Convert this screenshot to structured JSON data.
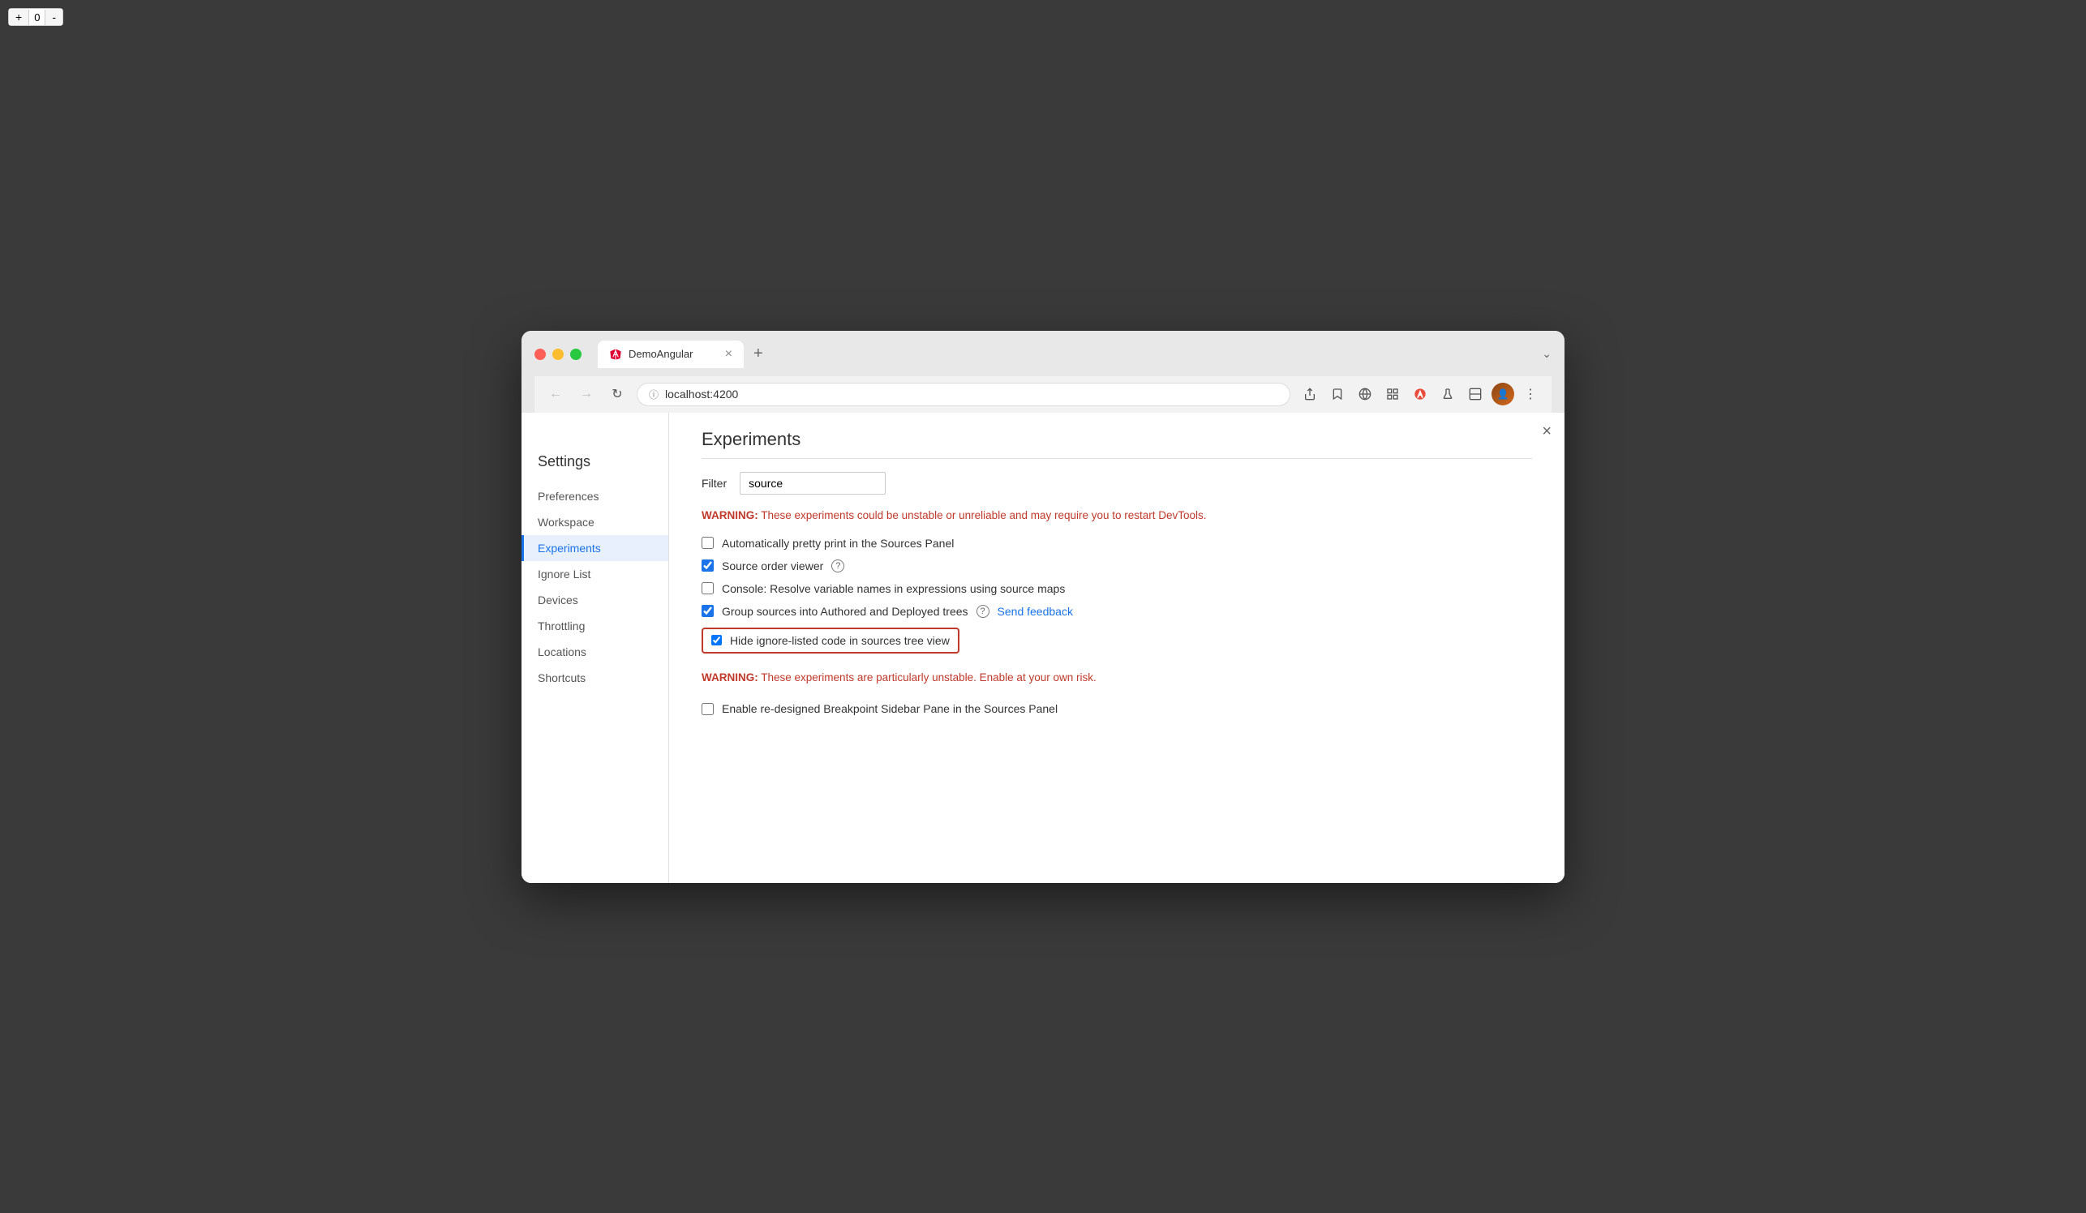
{
  "browser": {
    "tab_title": "DemoAngular",
    "tab_close": "×",
    "tab_new": "+",
    "tab_expand": "⌄",
    "url": "localhost:4200",
    "nav": {
      "back": "←",
      "forward": "→",
      "reload": "↻",
      "more": "⋮"
    }
  },
  "counter": {
    "plus": "+",
    "value": "0",
    "minus": "-"
  },
  "settings": {
    "title": "Settings",
    "close": "×",
    "sidebar_items": [
      {
        "id": "preferences",
        "label": "Preferences",
        "active": false
      },
      {
        "id": "workspace",
        "label": "Workspace",
        "active": false
      },
      {
        "id": "experiments",
        "label": "Experiments",
        "active": true
      },
      {
        "id": "ignore-list",
        "label": "Ignore List",
        "active": false
      },
      {
        "id": "devices",
        "label": "Devices",
        "active": false
      },
      {
        "id": "throttling",
        "label": "Throttling",
        "active": false
      },
      {
        "id": "locations",
        "label": "Locations",
        "active": false
      },
      {
        "id": "shortcuts",
        "label": "Shortcuts",
        "active": false
      }
    ],
    "experiments": {
      "title": "Experiments",
      "filter_label": "Filter",
      "filter_value": "source",
      "filter_placeholder": "Filter",
      "warning1": "WARNING: These experiments could be unstable or unreliable and may require you to restart DevTools.",
      "warning1_label": "WARNING:",
      "warning1_rest": " These experiments could be unstable or unreliable and may require you to restart DevTools.",
      "items": [
        {
          "id": "auto-pretty-print",
          "label": "Automatically pretty print in the Sources Panel",
          "checked": false,
          "has_help": false,
          "has_feedback": false,
          "highlighted": false
        },
        {
          "id": "source-order-viewer",
          "label": "Source order viewer",
          "checked": true,
          "has_help": true,
          "has_feedback": false,
          "highlighted": false
        },
        {
          "id": "console-resolve-vars",
          "label": "Console: Resolve variable names in expressions using source maps",
          "checked": false,
          "has_help": false,
          "has_feedback": false,
          "highlighted": false
        },
        {
          "id": "group-sources",
          "label": "Group sources into Authored and Deployed trees",
          "checked": true,
          "has_help": true,
          "has_feedback": true,
          "highlighted": false
        },
        {
          "id": "hide-ignore-listed",
          "label": "Hide ignore-listed code in sources tree view",
          "checked": true,
          "has_help": false,
          "has_feedback": false,
          "highlighted": true
        }
      ],
      "warning2": "WARNING: These experiments are particularly unstable. Enable at your own risk.",
      "warning2_label": "WARNING:",
      "warning2_rest": " These experiments are particularly unstable. Enable at your own risk.",
      "items2": [
        {
          "id": "breakpoint-sidebar",
          "label": "Enable re-designed Breakpoint Sidebar Pane in the Sources Panel",
          "checked": false,
          "highlighted": false
        }
      ],
      "send_feedback_label": "Send feedback",
      "help_icon": "?"
    }
  }
}
